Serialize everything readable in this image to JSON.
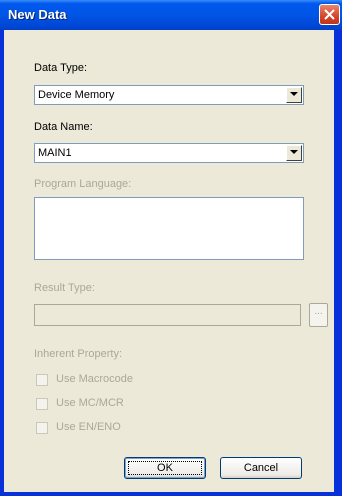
{
  "window": {
    "title": "New Data"
  },
  "data_type": {
    "label": "Data Type:",
    "value": "Device Memory"
  },
  "data_name": {
    "label": "Data Name:",
    "value": "MAIN1"
  },
  "program_language": {
    "label": "Program Language:"
  },
  "result_type": {
    "label": "Result Type:",
    "value": "",
    "browse_label": "..."
  },
  "inherent_property": {
    "label": "Inherent Property:",
    "options": [
      {
        "label": "Use Macrocode",
        "checked": false
      },
      {
        "label": "Use MC/MCR",
        "checked": false
      },
      {
        "label": "Use EN/ENO",
        "checked": false
      }
    ]
  },
  "buttons": {
    "ok": "OK",
    "cancel": "Cancel"
  },
  "colors": {
    "titlebar": "#0055e5",
    "face": "#ece9d8",
    "disabled_text": "#aca899",
    "close_red": "#d4452a"
  }
}
